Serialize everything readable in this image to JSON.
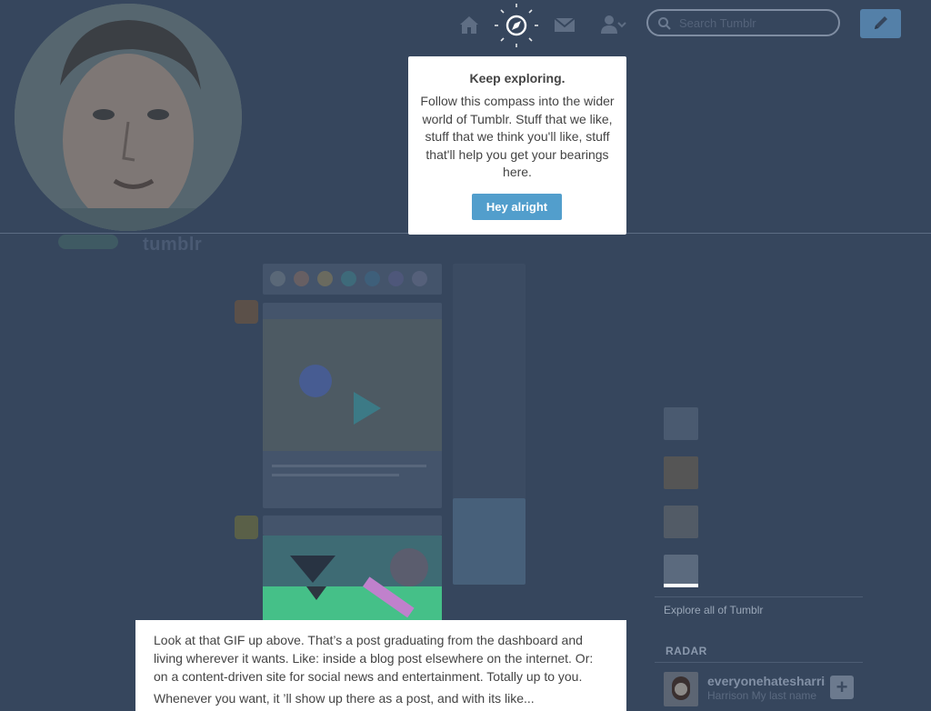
{
  "tooltip": {
    "title": "Keep exploring.",
    "body": "Follow this compass into the wider world of Tumblr. Stuff that we like, stuff that we think you'll like, stuff that'll help you get your bearings here.",
    "button_label": "Hey alright"
  },
  "header": {
    "search_placeholder": "Search Tumblr",
    "logo_text": "tumblr",
    "nav_icons": [
      "home-icon",
      "compass-icon",
      "mail-icon",
      "account-icon",
      "compose-icon"
    ]
  },
  "sidebar": {
    "explore_link": "Explore all of Tumblr",
    "radar_title": "RADAR",
    "radar_blog_name": "everyonehatesharrison",
    "radar_blog_subtitle": "Harrison My last name"
  },
  "info_panel": {
    "paragraph_1": "Look at that GIF up above. That’s a post graduating from the dashboard and living wherever it wants. Like: inside a blog post elsewhere on the internet. Or: on a content-driven site for social news and entertainment. Totally up to you.",
    "paragraph_2": "Whenever you want, it ’ll show up there as a post, and with its like..."
  },
  "colors": {
    "dim_background": "#36465d",
    "accent_blue": "#529ecc",
    "tooltip_bg": "#ffffff",
    "text_dark": "#444444"
  }
}
